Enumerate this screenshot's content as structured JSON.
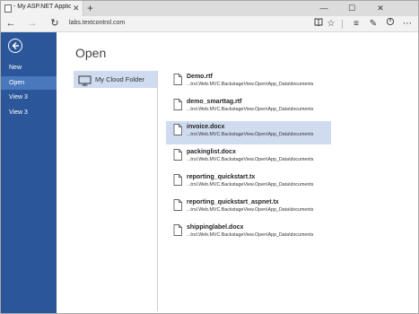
{
  "browser": {
    "tab_title": "- My ASP.NET Applicatio",
    "tab_close": "✕",
    "new_tab": "+",
    "window_controls": {
      "minimize": "—",
      "maximize": "☐",
      "close": "✕"
    },
    "nav": {
      "back": "←",
      "forward": "→",
      "refresh": "↻"
    },
    "url": "labs.textcontrol.com",
    "toolbar_icons": {
      "reading_view": "📖",
      "favorite": "☆",
      "hub": "≡",
      "notes": "✎",
      "share": "⤴"
    }
  },
  "sidebar": {
    "back_icon": "back-arrow-icon",
    "items": [
      {
        "label": "New",
        "active": false
      },
      {
        "label": "Open",
        "active": true
      },
      {
        "label": "View 3",
        "active": false
      },
      {
        "label": "View 3",
        "active": false
      }
    ],
    "colors": {
      "background": "#2b579a",
      "active": "#4a78bd"
    }
  },
  "main": {
    "title": "Open",
    "location": {
      "label": "My Cloud Folder",
      "icon": "monitor-icon"
    },
    "files": [
      {
        "name": "Demo.rtf",
        "path": "...trol.Web.MVC.BackstageView.Open\\App_Data\\documents",
        "selected": false
      },
      {
        "name": "demo_smarttag.rtf",
        "path": "...trol.Web.MVC.BackstageView.Open\\App_Data\\documents",
        "selected": false
      },
      {
        "name": "invoice.docx",
        "path": "...trol.Web.MVC.BackstageView.Open\\App_Data\\documents",
        "selected": true
      },
      {
        "name": "packinglist.docx",
        "path": "...trol.Web.MVC.BackstageView.Open\\App_Data\\documents",
        "selected": false
      },
      {
        "name": "reporting_quickstart.tx",
        "path": "...trol.Web.MVC.BackstageView.Open\\App_Data\\documents",
        "selected": false
      },
      {
        "name": "reporting_quickstart_aspnet.tx",
        "path": "...trol.Web.MVC.BackstageView.Open\\App_Data\\documents",
        "selected": false
      },
      {
        "name": "shippinglabel.docx",
        "path": "...trol.Web.MVC.BackstageView.Open\\App_Data\\documents",
        "selected": false
      }
    ]
  }
}
